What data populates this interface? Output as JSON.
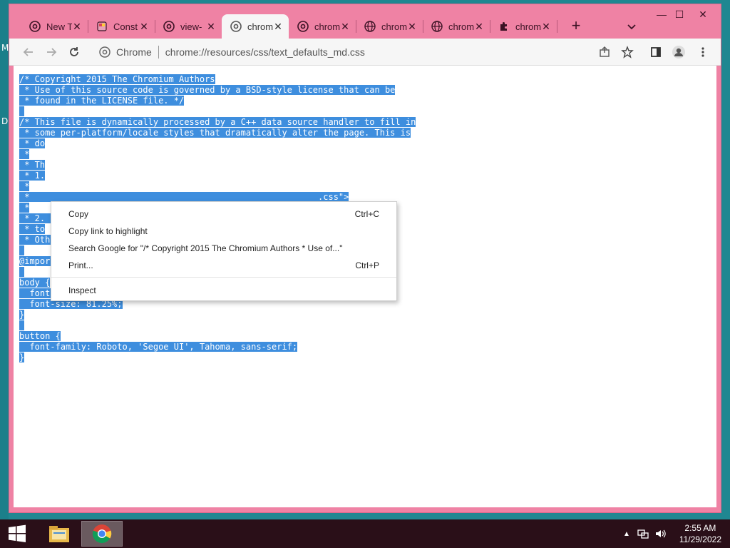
{
  "desktop": {
    "letters": [
      "M",
      "D"
    ]
  },
  "window": {
    "tabs": [
      {
        "title": "New Tab",
        "icon": "chrome-icon"
      },
      {
        "title": "Const",
        "icon": "page-icon"
      },
      {
        "title": "view-",
        "icon": "chrome-icon"
      },
      {
        "title": "chrom",
        "icon": "chrome-icon",
        "active": true
      },
      {
        "title": "chrom",
        "icon": "chrome-icon"
      },
      {
        "title": "chrom",
        "icon": "globe-icon"
      },
      {
        "title": "chrom",
        "icon": "globe-icon"
      },
      {
        "title": "chrom",
        "icon": "puzzle-icon"
      }
    ],
    "controls": {
      "minimize": "—",
      "maximize": "☐",
      "close": "✕"
    }
  },
  "toolbar": {
    "chip_label": "Chrome",
    "url": "chrome://resources/css/text_defaults_md.css"
  },
  "code_lines": [
    "/* Copyright 2015 The Chromium Authors",
    " * Use of this source code is governed by a BSD-style license that can be",
    " * found in the LICENSE file. */",
    " ",
    "/* This file is dynamically processed by a C++ data source handler to fill in",
    " * some per-platform/locale styles that dramatically alter the page. This is",
    " * do",
    " *",
    " * Th",
    " * 1.",
    " *",
    " *                                                        .css\">",
    " *",
    " * 2.                                                       pend it",
    " * to",
    " * Otherwise its placeholders won't be expanded. */",
    " ",
    "@import url(chrome://resources/css/roboto.css);",
    " ",
    "body {",
    "  font-family: Roboto, 'Segoe UI', Tahoma, sans-serif;",
    "  font-size: 81.25%;",
    "}",
    " ",
    "button {",
    "  font-family: Roboto, 'Segoe UI', Tahoma, sans-serif;",
    "}"
  ],
  "context_menu": {
    "copy": {
      "label": "Copy",
      "shortcut": "Ctrl+C"
    },
    "copy_link": {
      "label": "Copy link to highlight"
    },
    "search": {
      "label": "Search Google for \"/* Copyright 2015 The Chromium Authors  * Use of...\""
    },
    "print": {
      "label": "Print...",
      "shortcut": "Ctrl+P"
    },
    "inspect": {
      "label": "Inspect"
    }
  },
  "taskbar": {
    "time": "2:55 AM",
    "date": "11/29/2022"
  },
  "colors": {
    "window_frame": "#ef82a4",
    "selection": "#3e8ede",
    "taskbar": "#2a0f18"
  }
}
